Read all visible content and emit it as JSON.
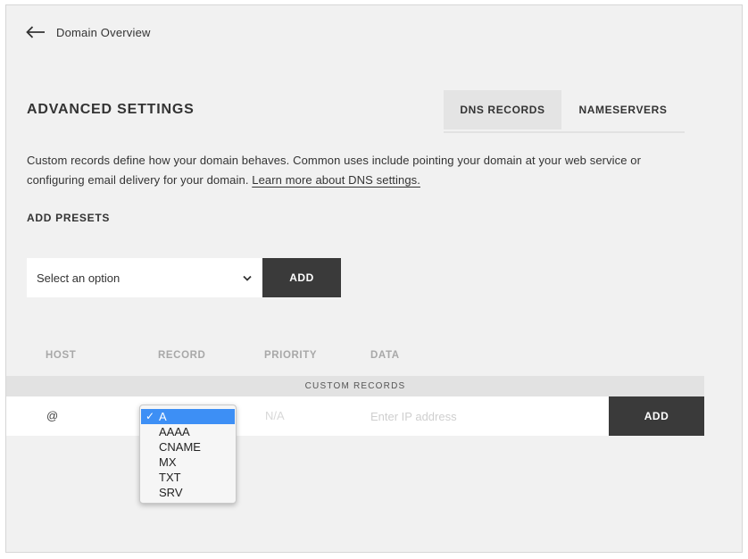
{
  "nav": {
    "back_label": "Domain Overview"
  },
  "page": {
    "title": "ADVANCED SETTINGS",
    "tabs": [
      {
        "label": "DNS RECORDS",
        "active": true
      },
      {
        "label": "NAMESERVERS",
        "active": false
      }
    ],
    "description": "Custom records define how your domain behaves. Common uses include pointing your domain at your web service or configuring email delivery for your domain.",
    "learn_more_link": "Learn more about DNS settings."
  },
  "presets": {
    "label": "ADD PRESETS",
    "select_value": "Select an option",
    "add_label": "ADD"
  },
  "table": {
    "columns": [
      "HOST",
      "RECORD",
      "PRIORITY",
      "DATA"
    ],
    "section_label": "CUSTOM RECORDS",
    "new_row": {
      "host": "@",
      "priority_placeholder": "N/A",
      "data_placeholder": "Enter IP address",
      "add_label": "ADD"
    }
  },
  "record_dropdown": {
    "options": [
      "A",
      "AAAA",
      "CNAME",
      "MX",
      "TXT",
      "SRV"
    ],
    "selected": "A",
    "check_mark": "✓"
  },
  "colors": {
    "background": "#f1f1f1",
    "dark_button": "#3a3a3a",
    "selection": "#3d8ff5"
  }
}
